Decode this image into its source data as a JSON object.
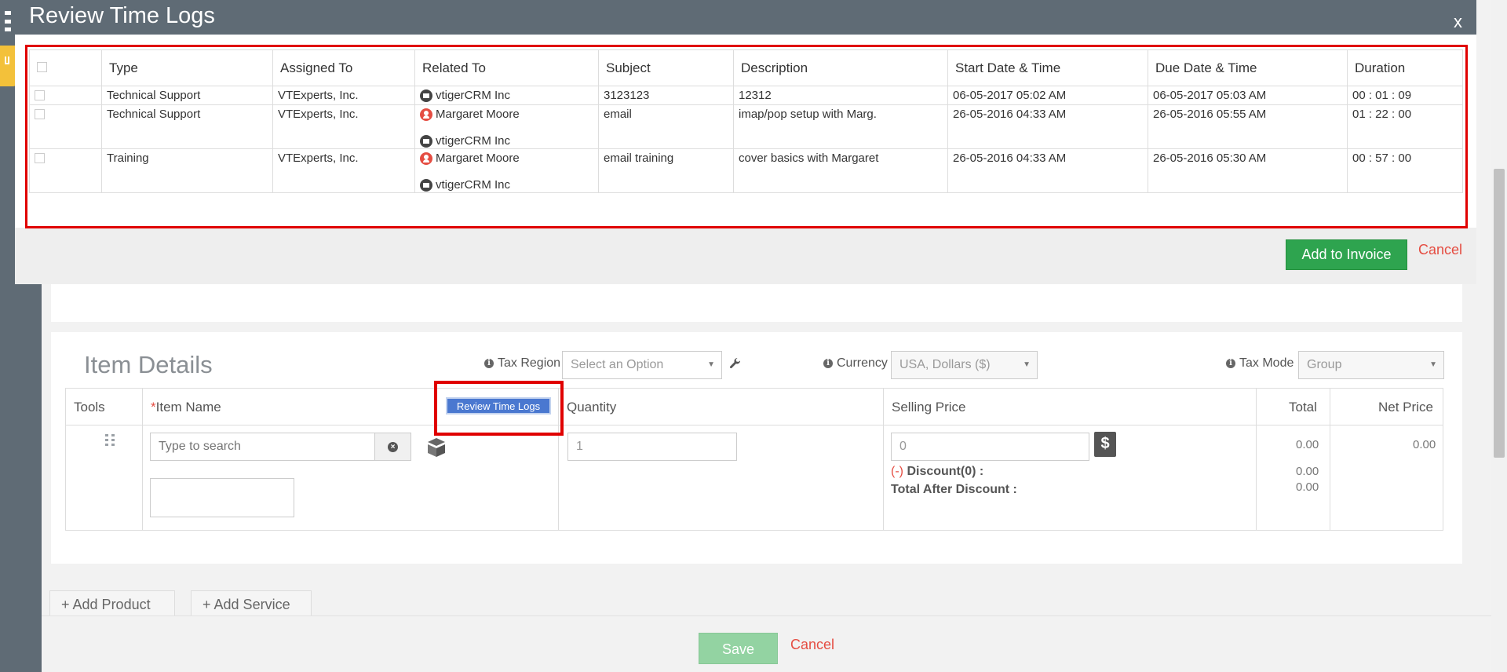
{
  "modal": {
    "title": "Review Time Logs",
    "close_label": "x",
    "columns": [
      "",
      "Type",
      "Assigned To",
      "Related To",
      "Subject",
      "Description",
      "Start Date & Time",
      "Due Date & Time",
      "Duration"
    ],
    "rows": [
      {
        "type": "Technical Support",
        "assigned_to": "VTExperts, Inc.",
        "related": [
          {
            "icon": "organization-icon",
            "name": "vtigerCRM Inc"
          }
        ],
        "subject": "3123123",
        "description": "12312",
        "start": "06-05-2017 05:02 AM",
        "due": "06-05-2017 05:03 AM",
        "duration": "00 : 01 : 09"
      },
      {
        "type": "Technical Support",
        "assigned_to": "VTExperts, Inc.",
        "related": [
          {
            "icon": "contact-icon",
            "name": "Margaret Moore"
          },
          {
            "icon": "organization-icon",
            "name": "vtigerCRM Inc"
          }
        ],
        "subject": "email",
        "description": "imap/pop setup with Marg.",
        "start": "26-05-2016 04:33 AM",
        "due": "26-05-2016 05:55 AM",
        "duration": "01 : 22 : 00"
      },
      {
        "type": "Training",
        "assigned_to": "VTExperts, Inc.",
        "related": [
          {
            "icon": "contact-icon",
            "name": "Margaret Moore"
          },
          {
            "icon": "organization-icon",
            "name": "vtigerCRM Inc"
          }
        ],
        "subject": "email training",
        "description": "cover basics with Margaret",
        "start": "26-05-2016 04:33 AM",
        "due": "26-05-2016 05:30 AM",
        "duration": "00 : 57 : 00"
      }
    ],
    "add_to_invoice_label": "Add to Invoice",
    "cancel_label": "Cancel"
  },
  "item_details": {
    "title": "Item Details",
    "tax_region_label": "Tax Region",
    "tax_region_value": "Select an Option",
    "currency_label": "Currency",
    "currency_value": "USA, Dollars ($)",
    "tax_mode_label": "Tax Mode",
    "tax_mode_value": "Group",
    "columns": {
      "tools": "Tools",
      "item_name": "Item Name",
      "required_mark": "*",
      "quantity": "Quantity",
      "selling_price": "Selling Price",
      "total": "Total",
      "net_price": "Net Price"
    },
    "review_time_logs_label": "Review Time Logs",
    "search_placeholder": "Type to search",
    "quantity_value": "1",
    "price_value": "0",
    "discount_prefix": "(-)",
    "discount_label": "Discount(0) :",
    "total_after_discount_label": "Total After Discount :",
    "total_value": "0.00",
    "discount_value": "0.00",
    "after_discount_value": "0.00",
    "net_price_value": "0.00"
  },
  "actions": {
    "add_product": "Add Product",
    "add_service": "Add Service",
    "plus": "+"
  },
  "footer": {
    "save_label": "Save",
    "cancel_label": "Cancel"
  },
  "colors": {
    "header": "#5f6b75",
    "accent_green": "#2ea44f",
    "highlight_red": "#e00000",
    "link_red": "#e54d42"
  }
}
